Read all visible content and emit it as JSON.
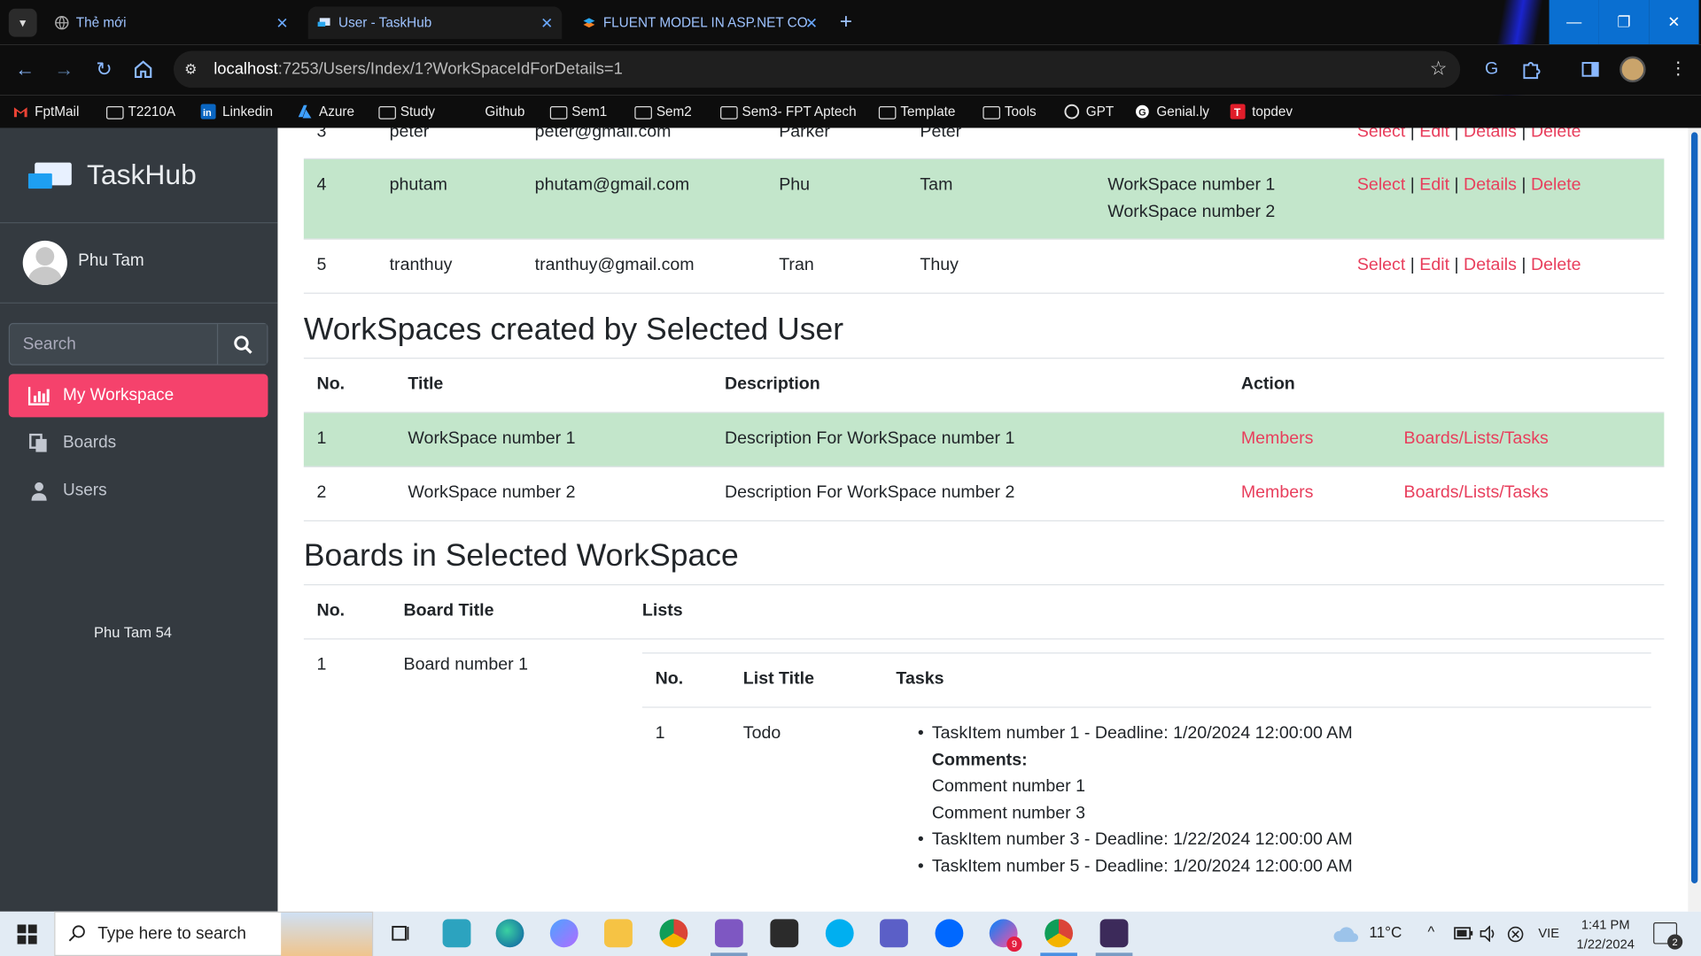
{
  "browser": {
    "tabs": [
      {
        "title": "Thẻ mới",
        "active": false
      },
      {
        "title": "User - TaskHub",
        "active": true
      },
      {
        "title": "FLUENT MODEL IN ASP.NET CO",
        "active": false
      }
    ],
    "url_host": "localhost",
    "url_rest": ":7253/Users/Index/1?WorkSpaceIdForDetails=1",
    "bookmarks": [
      "FptMail",
      "T2210A",
      "Linkedin",
      "Azure",
      "Study",
      "Github",
      "Sem1",
      "Sem2",
      "Sem3- FPT Aptech",
      "Template",
      "Tools",
      "GPT",
      "Genial.ly",
      "topdev"
    ]
  },
  "sidebar": {
    "brand": "TaskHub",
    "user_name": "Phu Tam",
    "search_placeholder": "Search",
    "nav": [
      {
        "label": "My Workspace",
        "icon": "chart-bar-icon",
        "active": true
      },
      {
        "label": "Boards",
        "icon": "copy-icon",
        "active": false
      },
      {
        "label": "Users",
        "icon": "user-icon",
        "active": false
      }
    ],
    "footer": "Phu Tam 54"
  },
  "colors": {
    "accent": "#f5426c",
    "link": "#e83e5c",
    "selected_row": "#c3e6cb",
    "sidebar_bg": "#343a40",
    "taskbar_bg": "#e2ebf4"
  },
  "users_table": {
    "partial_row": {
      "id": "3",
      "username": "peter",
      "email": "peter@gmail.com",
      "first": "Parker",
      "last": "Peter"
    },
    "rows": [
      {
        "id": "4",
        "username": "phutam",
        "email": "phutam@gmail.com",
        "first": "Phu",
        "last": "Tam",
        "workspaces": [
          "WorkSpace number 1",
          "WorkSpace number 2"
        ],
        "selected": true
      },
      {
        "id": "5",
        "username": "tranthuy",
        "email": "tranthuy@gmail.com",
        "first": "Tran",
        "last": "Thuy",
        "workspaces": [],
        "selected": false
      }
    ],
    "actions": [
      "Select",
      "Edit",
      "Details",
      "Delete"
    ],
    "separator": "|"
  },
  "workspaces_section": {
    "title": "WorkSpaces created by Selected User",
    "headers": [
      "No.",
      "Title",
      "Description",
      "Action"
    ],
    "rows": [
      {
        "no": "1",
        "title": "WorkSpace number 1",
        "description": "Description For WorkSpace number 1",
        "members": "Members",
        "boards": "Boards/Lists/Tasks",
        "selected": true
      },
      {
        "no": "2",
        "title": "WorkSpace number 2",
        "description": "Description For WorkSpace number 2",
        "members": "Members",
        "boards": "Boards/Lists/Tasks",
        "selected": false
      }
    ]
  },
  "boards_section": {
    "title": "Boards in Selected WorkSpace",
    "headers": [
      "No.",
      "Board Title",
      "Lists"
    ],
    "rows": [
      {
        "no": "1",
        "title": "Board number 1"
      }
    ],
    "lists_table": {
      "headers": [
        "No.",
        "List Title",
        "Tasks"
      ],
      "rows": [
        {
          "no": "1",
          "title": "Todo"
        }
      ],
      "tasks": [
        {
          "text": "TaskItem number 1 - Deadline: 1/20/2024 12:00:00 AM",
          "comments_label": "Comments:",
          "comments": [
            "Comment number 1",
            "Comment number 3"
          ]
        },
        {
          "text": "TaskItem number 3 - Deadline: 1/22/2024 12:00:00 AM"
        },
        {
          "text": "TaskItem number 5 - Deadline: 1/20/2024 12:00:00 AM"
        }
      ]
    }
  },
  "taskbar": {
    "search_placeholder": "Type here to search",
    "weather": "11°C",
    "language": "VIE",
    "time": "1:41 PM",
    "date": "1/22/2024",
    "notification_count": "2",
    "messenger_badge": "9"
  }
}
